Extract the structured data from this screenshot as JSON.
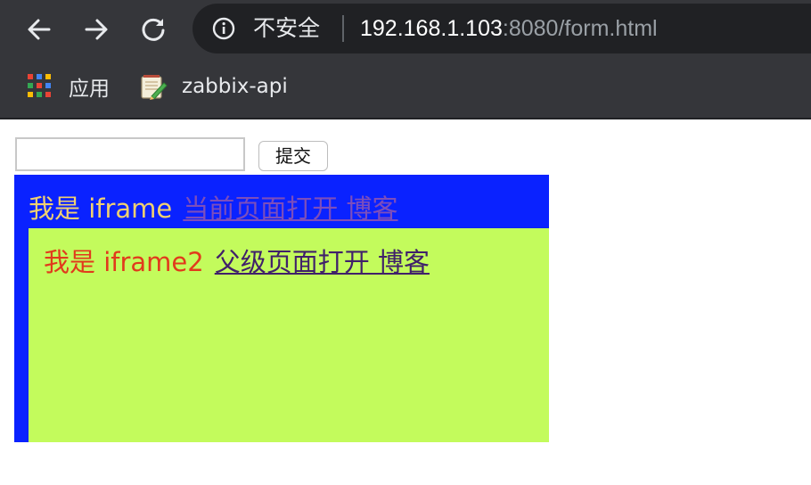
{
  "browser": {
    "security_label": "不安全",
    "url_host": "192.168.1.103",
    "url_rest": ":8080/form.html",
    "colors": {
      "chrome_bg": "#35363a",
      "omnibox_bg": "#202124"
    },
    "icons": {
      "back": "back-arrow-icon",
      "forward": "forward-arrow-icon",
      "reload": "reload-icon",
      "info": "info-icon"
    }
  },
  "bookmarks": {
    "items": [
      {
        "label": "应用",
        "icon": "apps-grid-icon"
      },
      {
        "label": "zabbix-api",
        "icon": "notepad-favicon-icon"
      }
    ]
  },
  "form": {
    "input_value": "",
    "submit_label": "提交"
  },
  "iframe1": {
    "intro": "我是 iframe",
    "link": "当前页面打开 博客",
    "colors": {
      "background": "#0a22ff",
      "intro_text": "#f0d071",
      "link_text": "#7d4ebb"
    }
  },
  "iframe2": {
    "intro": "我是 iframe2",
    "link": "父级页面打开 博客",
    "colors": {
      "background": "#c3fb5c",
      "intro_text": "#e13a1c",
      "link_text": "#40206a"
    }
  }
}
